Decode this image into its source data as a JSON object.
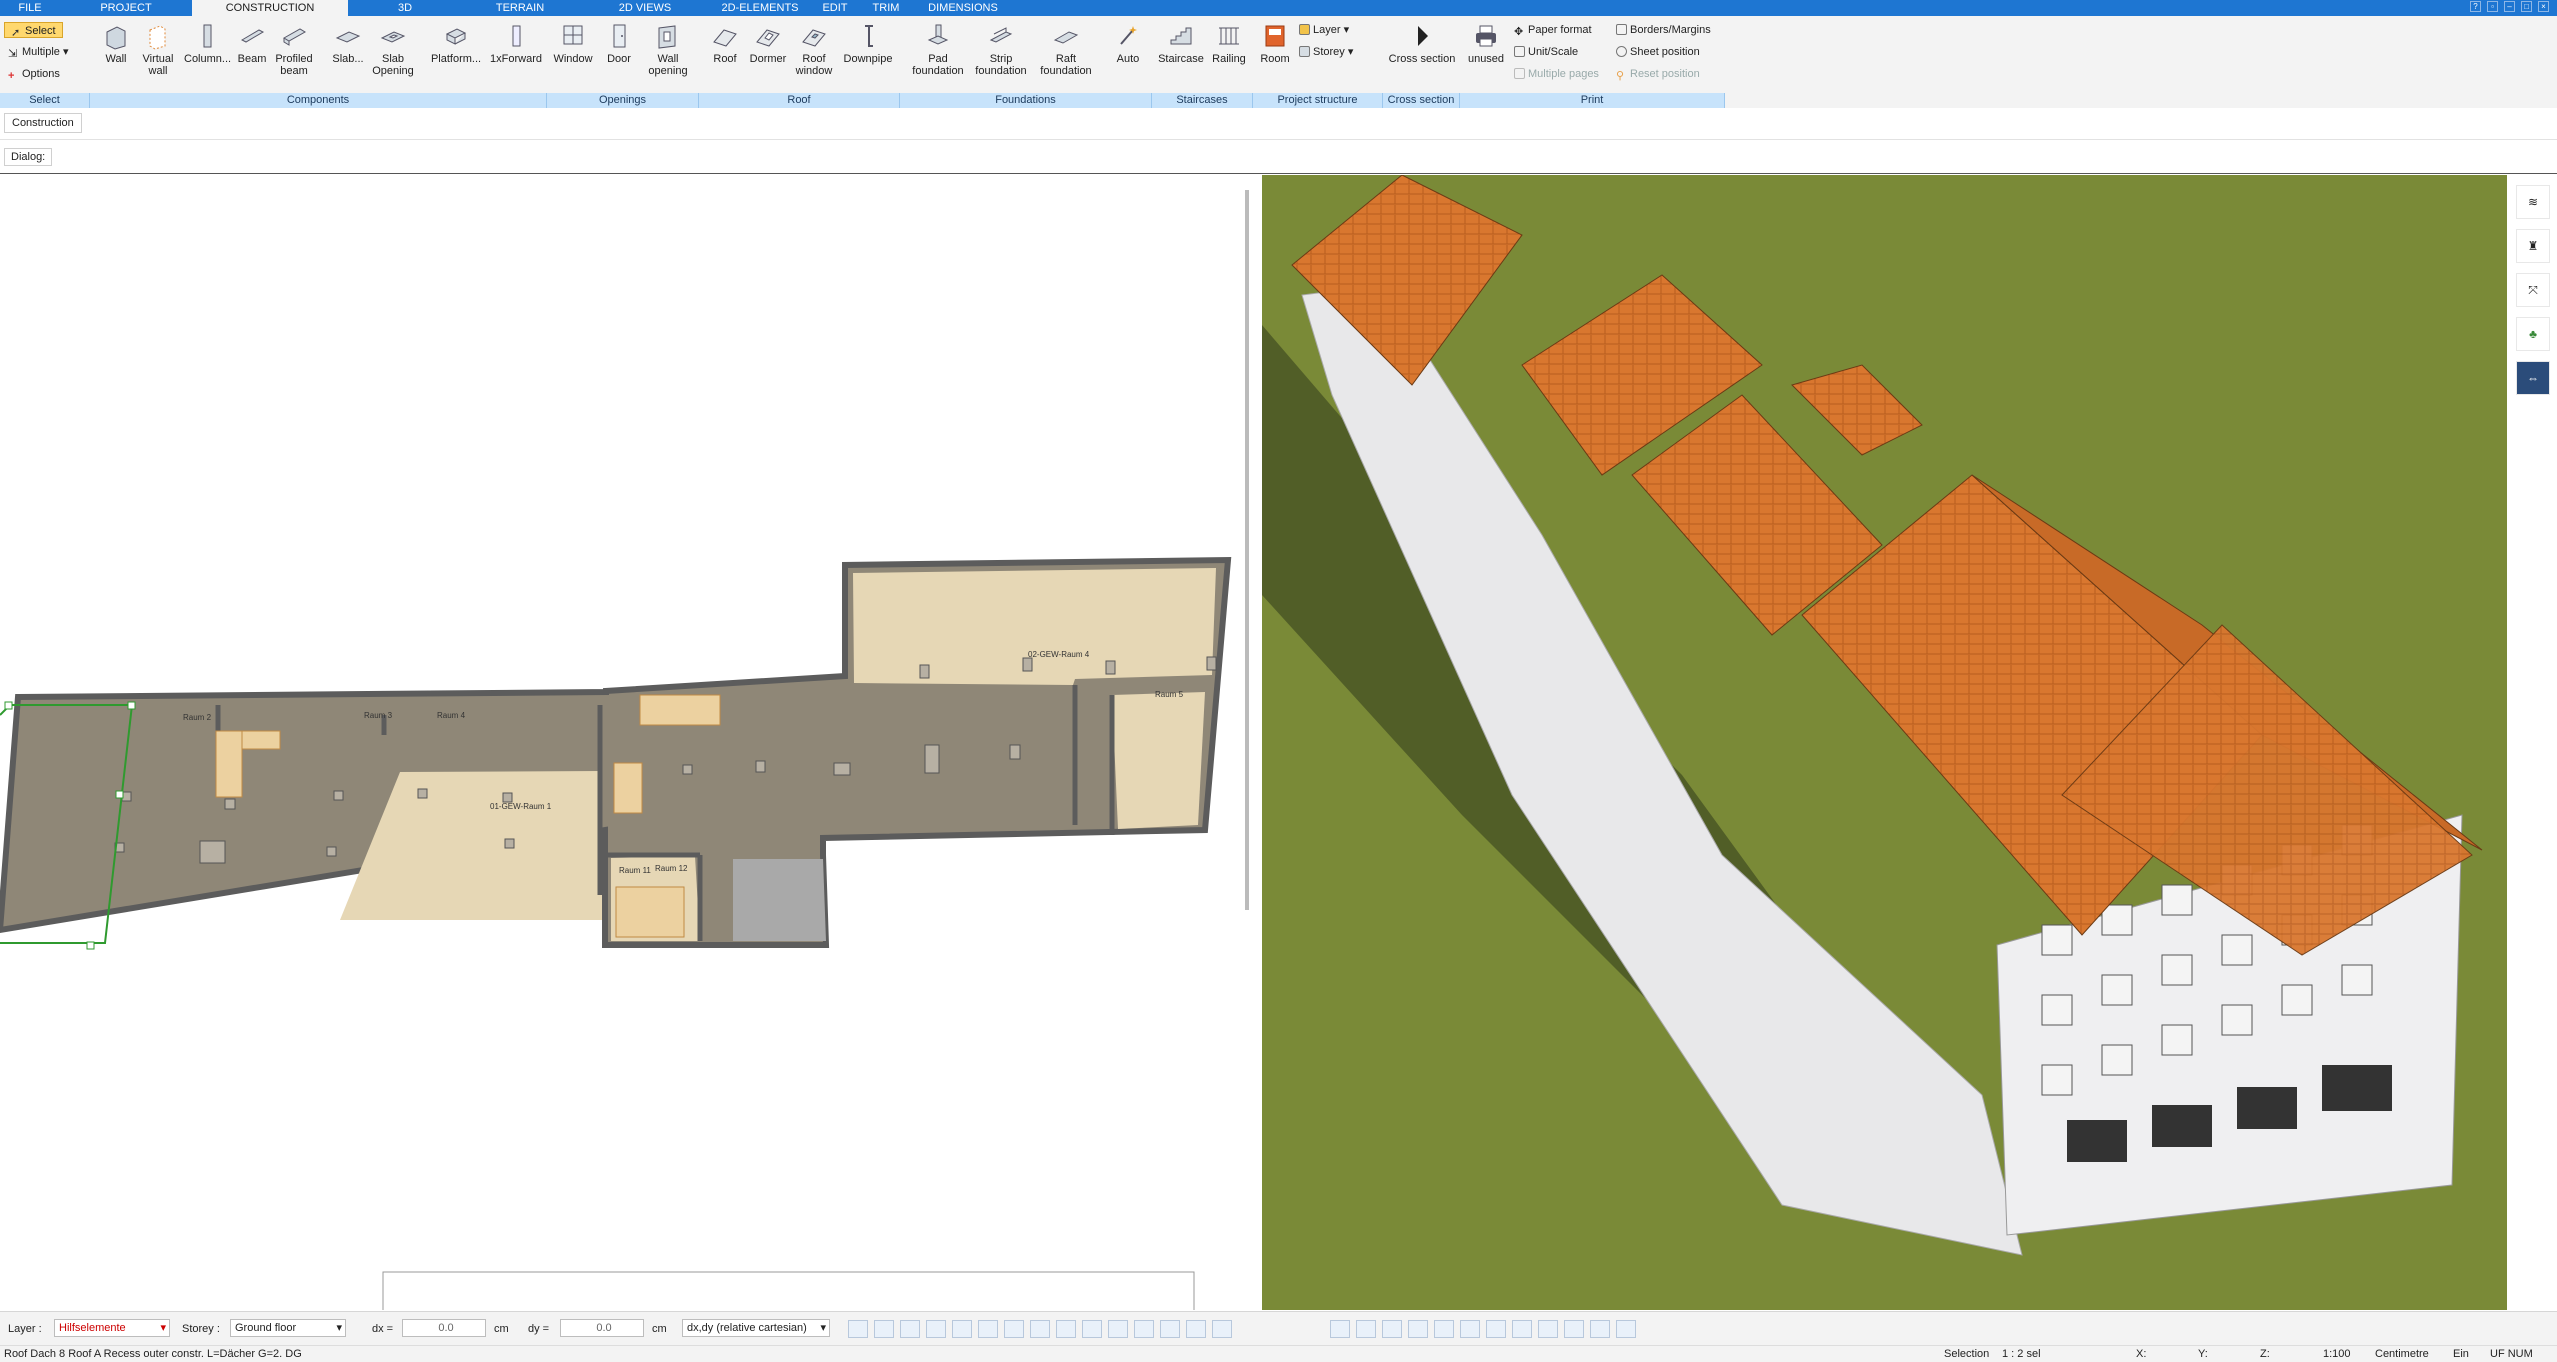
{
  "menu": {
    "tabs": [
      "FILE",
      "PROJECT",
      "CONSTRUCTION",
      "3D",
      "TERRAIN",
      "2D VIEWS",
      "2D-ELEMENTS",
      "EDIT",
      "TRIM",
      "DIMENSIONS"
    ]
  },
  "ribbon": {
    "select": {
      "select": "Select",
      "multiple": "Multiple",
      "options": "Options",
      "group": "Select"
    },
    "components": {
      "wall": "Wall",
      "virtual_wall": "Virtual wall",
      "column": "Column...",
      "beam": "Beam",
      "profiled_beam": "Profiled beam",
      "slab": "Slab...",
      "slab_opening": "Slab Opening",
      "platform": "Platform...",
      "forward": "1xForward",
      "group": "Components"
    },
    "openings": {
      "window": "Window",
      "door": "Door",
      "wall_opening": "Wall opening",
      "group": "Openings"
    },
    "roof": {
      "roof": "Roof",
      "dormer": "Dormer",
      "roof_window": "Roof window",
      "downpipe": "Downpipe",
      "group": "Roof"
    },
    "foundations": {
      "pad": "Pad foundation",
      "strip": "Strip foundation",
      "raft": "Raft foundation",
      "auto": "Auto",
      "group": "Foundations"
    },
    "staircases": {
      "staircase": "Staircase",
      "railing": "Railing",
      "group": "Staircases"
    },
    "project_structure": {
      "room": "Room",
      "layer": "Layer",
      "storey": "Storey",
      "group": "Project structure"
    },
    "cross_section": {
      "cross_section": "Cross section",
      "group": "Cross section"
    },
    "print": {
      "unused": "unused",
      "paper_format": "Paper format",
      "unit_scale": "Unit/Scale",
      "multiple_pages": "Multiple pages",
      "borders_margins": "Borders/Margins",
      "sheet_position": "Sheet position",
      "reset_position": "Reset position",
      "group": "Print"
    }
  },
  "tabs_bar": {
    "construction": "Construction"
  },
  "dialog_bar": {
    "label": "Dialog:"
  },
  "plan": {
    "rooms": [
      "01-GEW-Raum 1",
      "02-GEW-Raum 4",
      "Raum 5",
      "Raum 2",
      "Raum 3",
      "Raum 4",
      "Raum 11",
      "Raum 12"
    ]
  },
  "bottom": {
    "layer_label": "Layer :",
    "layer_value": "Hilfselemente",
    "storey_label": "Storey :",
    "storey_value": "Ground floor",
    "dx_label": "dx =",
    "dx_value": "0.0",
    "dx_unit": "cm",
    "dy_label": "dy =",
    "dy_value": "0.0",
    "dy_unit": "cm",
    "coord_mode": "dx,dy (relative cartesian)"
  },
  "status": {
    "message": "Roof Dach 8  Roof A Recess outer constr. L=Dächer G=2. DG",
    "selection_label": "Selection",
    "selection_value": "1 : 2 sel",
    "x": "X:",
    "y": "Y:",
    "z": "Z:",
    "scale": "1:100",
    "unit": "Centimetre",
    "ein": "Ein",
    "flags": "UF NUM"
  },
  "colors": {
    "accent": "#1e76d2",
    "group_label": "#c7e3fb",
    "roof": "#d9772f",
    "grass": "#7a8a37",
    "floor_dark": "#8f8777",
    "floor_light": "#e6d7b5"
  }
}
